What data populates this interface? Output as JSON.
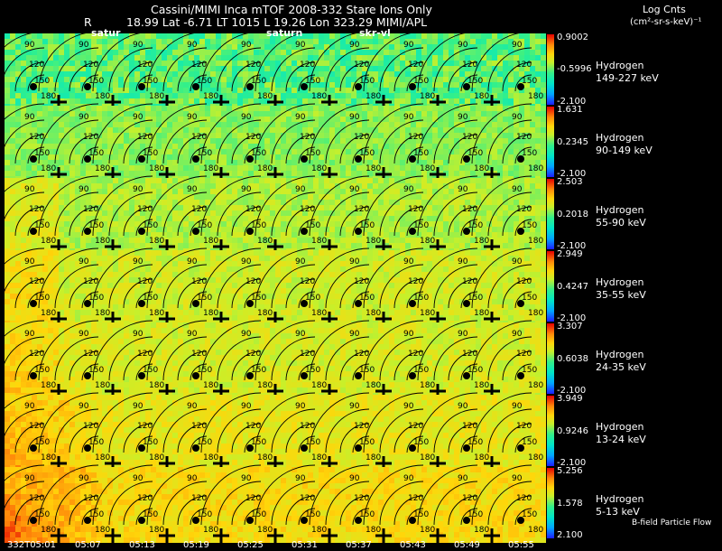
{
  "header": {
    "line1": "Cassini/MIMI Inca mTOF  2008-332   Stare    Ions Only",
    "r_label": "R",
    "line2": "18.99 Lat -6.71 LT 1015 L          19.26 Lon          323.29  MIMI/APL",
    "tag_satur": "satur",
    "tag_saturn": "saturn",
    "tag_skr": "skr-vl",
    "units_title": "Log Cnts",
    "units": "(cm²-sr-s-keV)⁻¹"
  },
  "footer": {
    "times": [
      "332T05:01",
      "05:07",
      "05:13",
      "05:19",
      "05:25",
      "05:31",
      "05:37",
      "05:43",
      "05:49",
      "05:55"
    ],
    "legend_note": "B-field Particle Flow"
  },
  "contour_labels": [
    "90",
    "120",
    "150",
    "180"
  ],
  "colors": {
    "background": "#000000",
    "scale": [
      "#1d1dff",
      "#00a6ff",
      "#00e6c8",
      "#33f08a",
      "#9cf23b",
      "#e9f01e",
      "#ffd60a",
      "#ff9b0a",
      "#ff4a00",
      "#e60000"
    ]
  },
  "chart_data": {
    "type": "heatmap",
    "rows": [
      {
        "species": "Hydrogen",
        "energy": "149-227 keV",
        "cb_max": "0.9002",
        "cb_mid": "-0.5996",
        "cb_min": "-2.100",
        "level": 0.48,
        "spread": 0.1
      },
      {
        "species": "Hydrogen",
        "energy": "90-149 keV",
        "cb_max": "1.631",
        "cb_mid": "0.2345",
        "cb_min": "-2.100",
        "level": 0.54,
        "spread": 0.05
      },
      {
        "species": "Hydrogen",
        "energy": "55-90 keV",
        "cb_max": "2.503",
        "cb_mid": "0.2018",
        "cb_min": "-2.100",
        "level": 0.58,
        "spread": 0.05
      },
      {
        "species": "Hydrogen",
        "energy": "35-55 keV",
        "cb_max": "2.949",
        "cb_mid": "0.4247",
        "cb_min": "-2.100",
        "level": 0.62,
        "spread": 0.05
      },
      {
        "species": "Hydrogen",
        "energy": "24-35 keV",
        "cb_max": "3.307",
        "cb_mid": "0.6038",
        "cb_min": "-2.100",
        "level": 0.63,
        "spread": 0.05
      },
      {
        "species": "Hydrogen",
        "energy": "13-24 keV",
        "cb_max": "3.949",
        "cb_mid": "0.9246",
        "cb_min": "-2.100",
        "level": 0.66,
        "spread": 0.05
      },
      {
        "species": "Hydrogen",
        "energy": "5-13 keV",
        "cb_max": "5.256",
        "cb_mid": "1.578",
        "cb_min": "2.100",
        "level": 0.7,
        "spread": 0.05
      }
    ],
    "columns": 10
  }
}
